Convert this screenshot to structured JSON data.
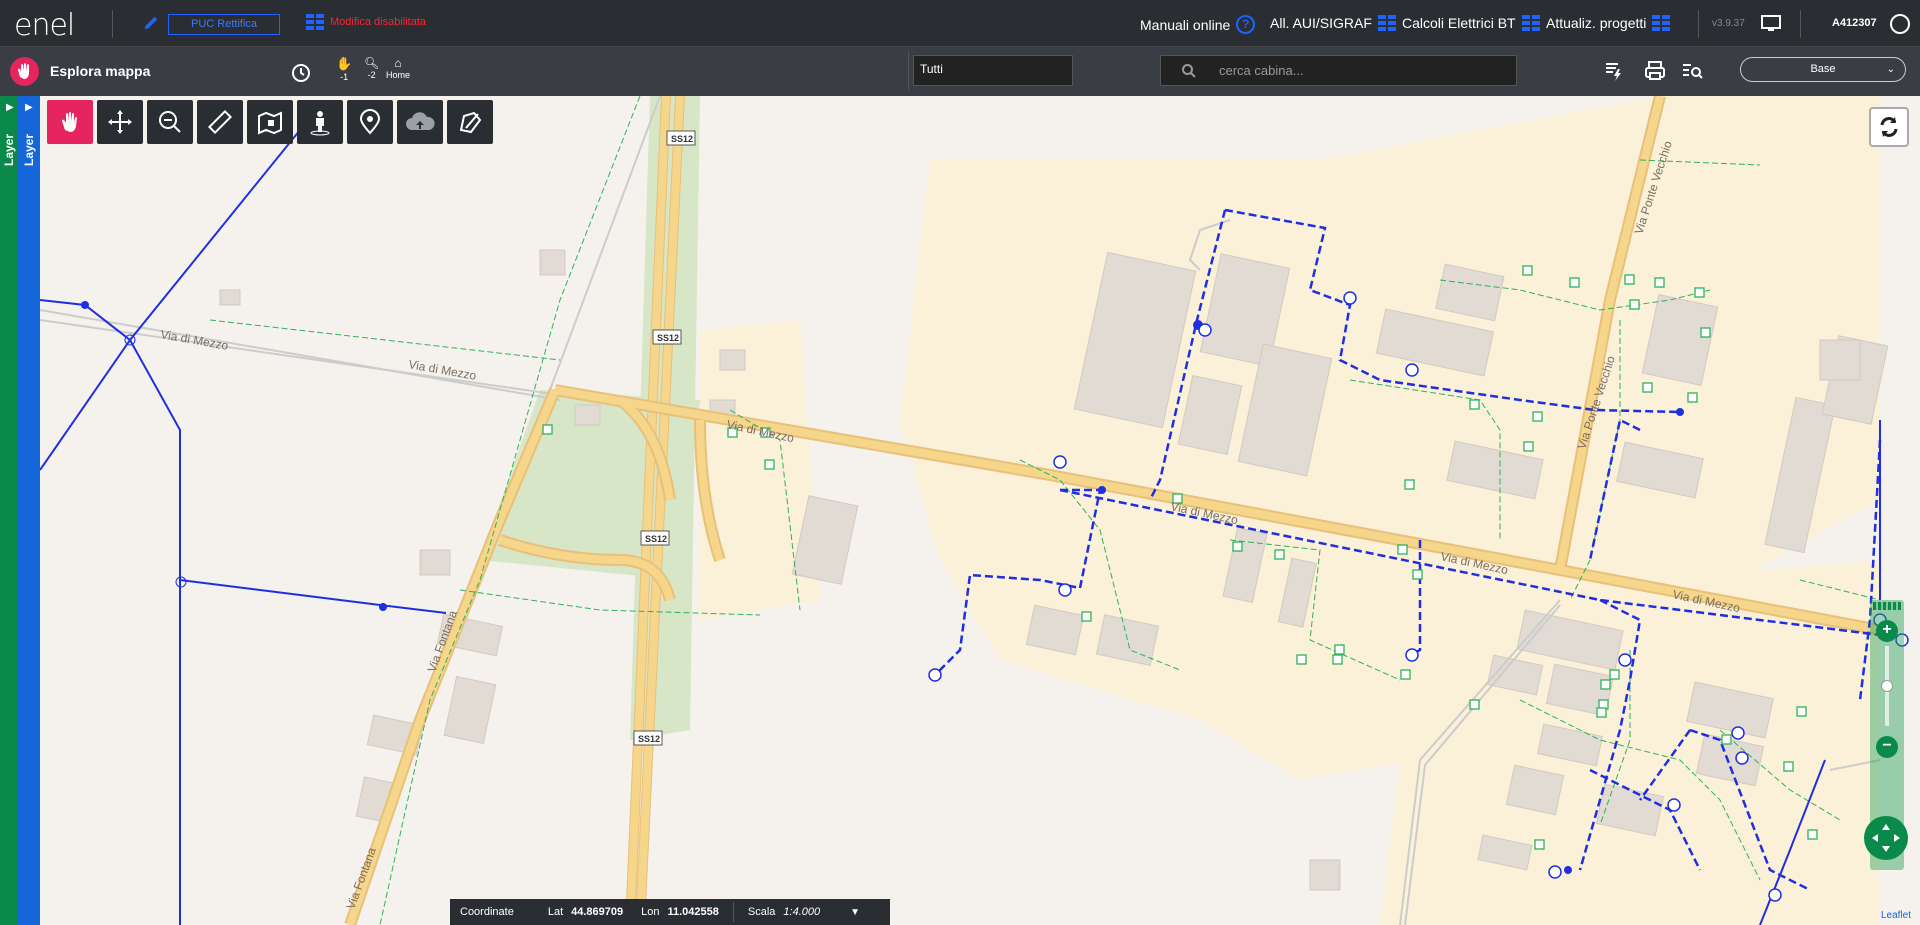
{
  "header": {
    "logo": "enel",
    "puc_button": "PUC Rettifica",
    "modifica_label": "Modifica disabilitata",
    "manuali": "Manuali online",
    "all_aui": "All. AUI/SIGRAF",
    "calcoli": "Calcoli Elettrici BT",
    "attualiz": "Attualiz. progetti",
    "version": "v3.9.37",
    "user_id": "A412307"
  },
  "subbar": {
    "title": "Esplora mappa",
    "nav_back_label": "-1",
    "nav_zoom_label": "-2",
    "home_label": "Home",
    "filter_value": "Tutti",
    "search_placeholder": "cerca cabina...",
    "base_layer": "Base"
  },
  "sidebar": {
    "layer_green": "Layer",
    "layer_blue": "Layer"
  },
  "map": {
    "roads": [
      "Via di Mezzo",
      "Via di Mezzo",
      "Via di Mezzo",
      "Via di Mezzo",
      "Via di Mezzo",
      "Via di Mezzo",
      "Via Fontana",
      "Via Fontana",
      "Via Ponte Vecchio",
      "Via Ponte Vecchio"
    ],
    "shields": [
      "SS12",
      "SS12",
      "SS12",
      "SS12"
    ],
    "attribution": "Leaflet"
  },
  "coords": {
    "label": "Coordinate",
    "lat_label": "Lat",
    "lat": "44.869709",
    "lon_label": "Lon",
    "lon": "11.042558",
    "scale_label": "Scala",
    "scale": "1:4.000"
  },
  "colors": {
    "accent": "#e6245e",
    "network_blue": "#1f2fe0",
    "network_green": "#2db35a",
    "road_yellow": "#f5d68a"
  }
}
